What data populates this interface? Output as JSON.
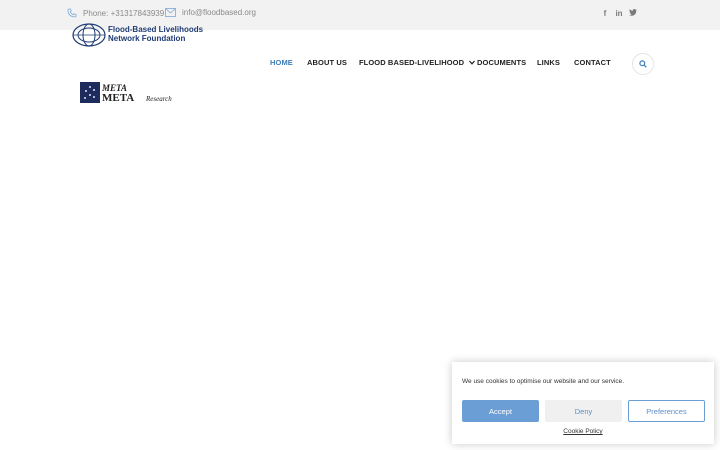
{
  "topbar": {
    "phone": "Phone: +31317843939",
    "email": "info@floodbased.org",
    "social": [
      "f",
      "in",
      "tw"
    ]
  },
  "header": {
    "logo_line1": "Flood-Based Livelihoods",
    "logo_line2": "Network Foundation",
    "partner_logo_text": "META",
    "partner_logo_sub": "Research"
  },
  "nav": {
    "items": [
      "HOME",
      "ABOUT US",
      "FLOOD BASED-LIVELIHOOD",
      "DOCUMENTS",
      "LINKS",
      "CONTACT"
    ]
  },
  "cookie": {
    "message": "We use cookies to optimise our website and our service.",
    "accept": "Accept",
    "deny": "Deny",
    "preferences": "Preferences",
    "policy": "Cookie Policy"
  },
  "colors": {
    "accent": "#3e7fb8",
    "button_blue": "#6c9ed6",
    "topbar_bg": "#f2f2f2"
  }
}
